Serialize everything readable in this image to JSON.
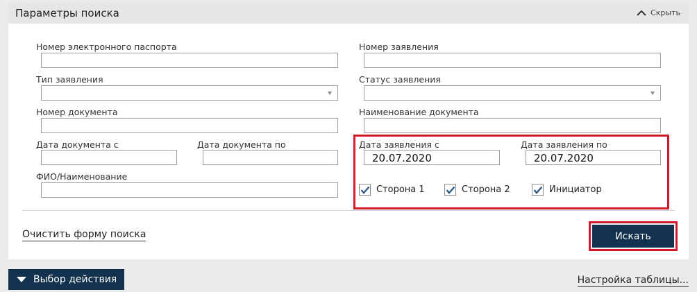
{
  "panel": {
    "title": "Параметры поиска",
    "hide_label": "Скрыть"
  },
  "fields": {
    "passport_number": {
      "label": "Номер электронного паспорта",
      "value": ""
    },
    "application_number": {
      "label": "Номер заявления",
      "value": ""
    },
    "application_type": {
      "label": "Тип заявления",
      "value": ""
    },
    "application_status": {
      "label": "Статус заявления",
      "value": ""
    },
    "document_number": {
      "label": "Номер документа",
      "value": ""
    },
    "document_name": {
      "label": "Наименование документа",
      "value": ""
    },
    "document_date_from": {
      "label": "Дата документа с",
      "value": ""
    },
    "document_date_to": {
      "label": "Дата документа по",
      "value": ""
    },
    "application_date_from": {
      "label": "Дата заявления с",
      "value": "20.07.2020"
    },
    "application_date_to": {
      "label": "Дата заявления по",
      "value": "20.07.2020"
    },
    "full_name": {
      "label": "ФИО/Наименование",
      "value": ""
    }
  },
  "checkboxes": [
    {
      "label": "Сторона 1",
      "checked": true
    },
    {
      "label": "Сторона 2",
      "checked": true
    },
    {
      "label": "Инициатор",
      "checked": true
    }
  ],
  "actions": {
    "clear_form": "Очистить форму поиска",
    "search": "Искать",
    "choose_action": "Выбор действия",
    "table_settings": "Настройка таблицы..."
  },
  "colors": {
    "primary": "#13324f",
    "highlight": "#d11a2a",
    "checkmark": "#2d5a87"
  },
  "icons": {
    "hide": "chevron-up-icon",
    "select": "caret-down-icon",
    "checkbox": "check-icon",
    "action": "triangle-down-icon"
  }
}
